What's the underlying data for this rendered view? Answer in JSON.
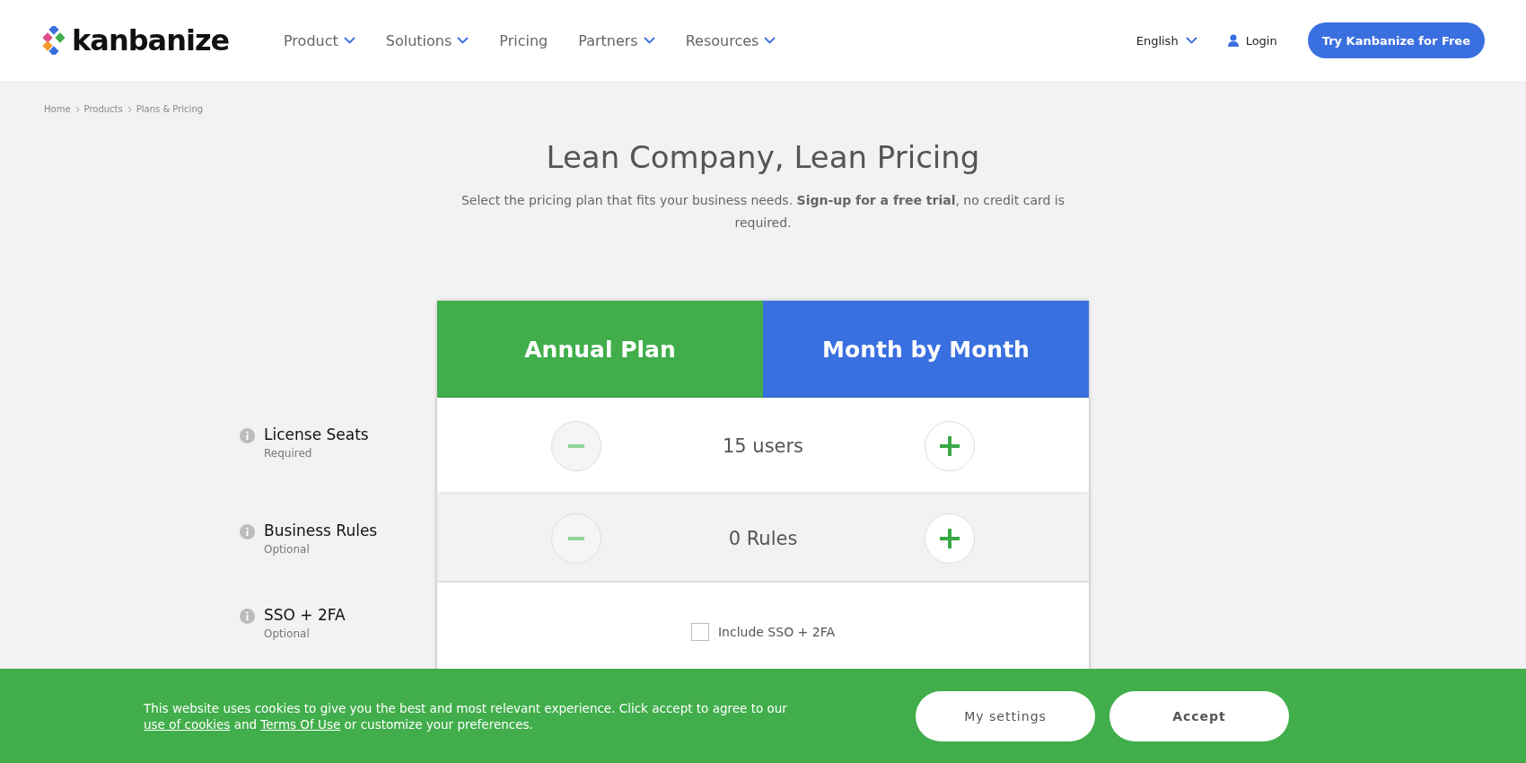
{
  "header": {
    "logo": "kanbanize",
    "nav": [
      {
        "label": "Product",
        "dropdown": true
      },
      {
        "label": "Solutions",
        "dropdown": true
      },
      {
        "label": "Pricing",
        "dropdown": false
      },
      {
        "label": "Partners",
        "dropdown": true
      },
      {
        "label": "Resources",
        "dropdown": true
      }
    ],
    "language": "English",
    "login": "Login",
    "cta": "Try Kanbanize for Free"
  },
  "breadcrumb": [
    "Home",
    "Products",
    "Plans & Pricing"
  ],
  "title": "Lean Company, Lean Pricing",
  "subtitle": "Select the pricing plan that fits your business needs. **Sign-up for a free trial**, no credit card is required.",
  "plans": [
    {
      "label": "Annual Plan",
      "color": "#41ae4b"
    },
    {
      "label": "Month by Month",
      "color": "#3a6fe0"
    }
  ],
  "options": [
    {
      "kind": "stepper",
      "name": "License Seats",
      "note": "Required",
      "value": "15 users",
      "minus_disabled": true
    },
    {
      "kind": "stepper",
      "name": "Business Rules",
      "note": "Optional",
      "value": "0 Rules",
      "minus_disabled": true
    },
    {
      "kind": "checkbox",
      "name": "SSO + 2FA",
      "note": "Optional",
      "label": "Include SSO + 2FA",
      "checked": false
    }
  ],
  "cookie_banner": {
    "parts": [
      {
        "kind": "text",
        "text": "This website uses cookies to give you the best and most relevant experience. Click accept to agree to our "
      },
      {
        "kind": "link",
        "text": "use of cookies"
      },
      {
        "kind": "text",
        "text": " and "
      },
      {
        "kind": "link",
        "text": "Terms Of Use"
      },
      {
        "kind": "text",
        "text": " or customize your preferences."
      }
    ],
    "buttons": [
      {
        "label": "My settings",
        "primary": false
      },
      {
        "label": "Accept",
        "primary": true
      }
    ]
  }
}
